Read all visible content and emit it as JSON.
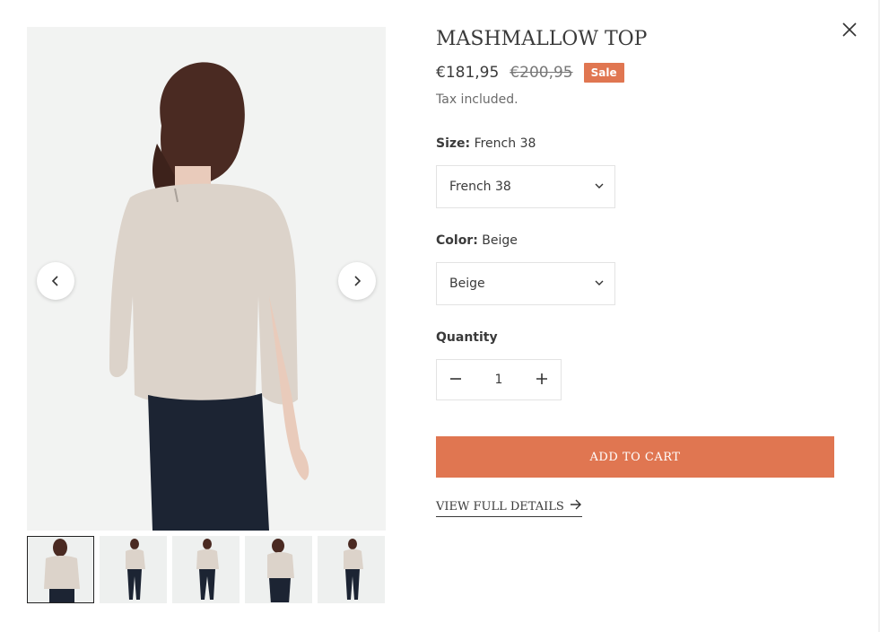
{
  "product": {
    "title": "MASHMALLOW TOP",
    "price": "€181,95",
    "compare_price": "€200,95",
    "sale_badge": "Sale",
    "tax_note": "Tax included."
  },
  "options": {
    "size": {
      "label": "Size:",
      "value": "French 38",
      "selected": "French 38"
    },
    "color": {
      "label": "Color:",
      "value": "Beige",
      "selected": "Beige"
    }
  },
  "quantity": {
    "label": "Quantity",
    "value": "1"
  },
  "actions": {
    "add_to_cart": "ADD TO CART",
    "view_details": "VIEW FULL DETAILS"
  },
  "icons": {
    "close": "close-icon",
    "prev": "chevron-left-icon",
    "next": "chevron-right-icon",
    "select": "chevron-down-icon",
    "minus": "minus-icon",
    "plus": "plus-icon",
    "arrow": "arrow-right-icon"
  },
  "colors": {
    "accent": "#e07651",
    "text": "#3a3a3a",
    "muted": "#6b6b6b",
    "border": "#e3e3e3"
  },
  "gallery": {
    "thumbnail_count": 5,
    "active_index": 0
  }
}
